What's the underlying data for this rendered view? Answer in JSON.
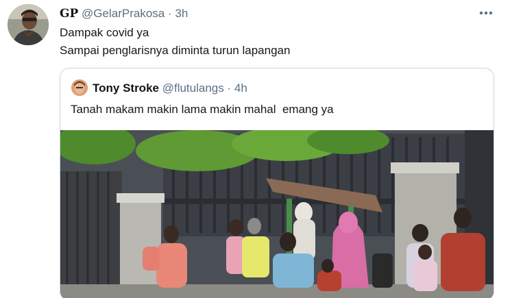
{
  "tweet": {
    "display_name": "GP",
    "handle": "@GelarPrakosa",
    "separator": "·",
    "time": "3h",
    "text_line1": "Dampak covid ya",
    "text_line2": "Sampai penglarisnya diminta turun lapangan",
    "more_icon": "more-horizontal-icon"
  },
  "quoted_tweet": {
    "display_name": "Tony Stroke",
    "handle": "@flutulangs",
    "separator": "·",
    "time": "4h",
    "text": "Tanah makam makin lama makin mahal  emang ya"
  },
  "colors": {
    "secondary_text": "#5b7083",
    "border": "#c9d3db",
    "accent": "#1da1f2"
  }
}
